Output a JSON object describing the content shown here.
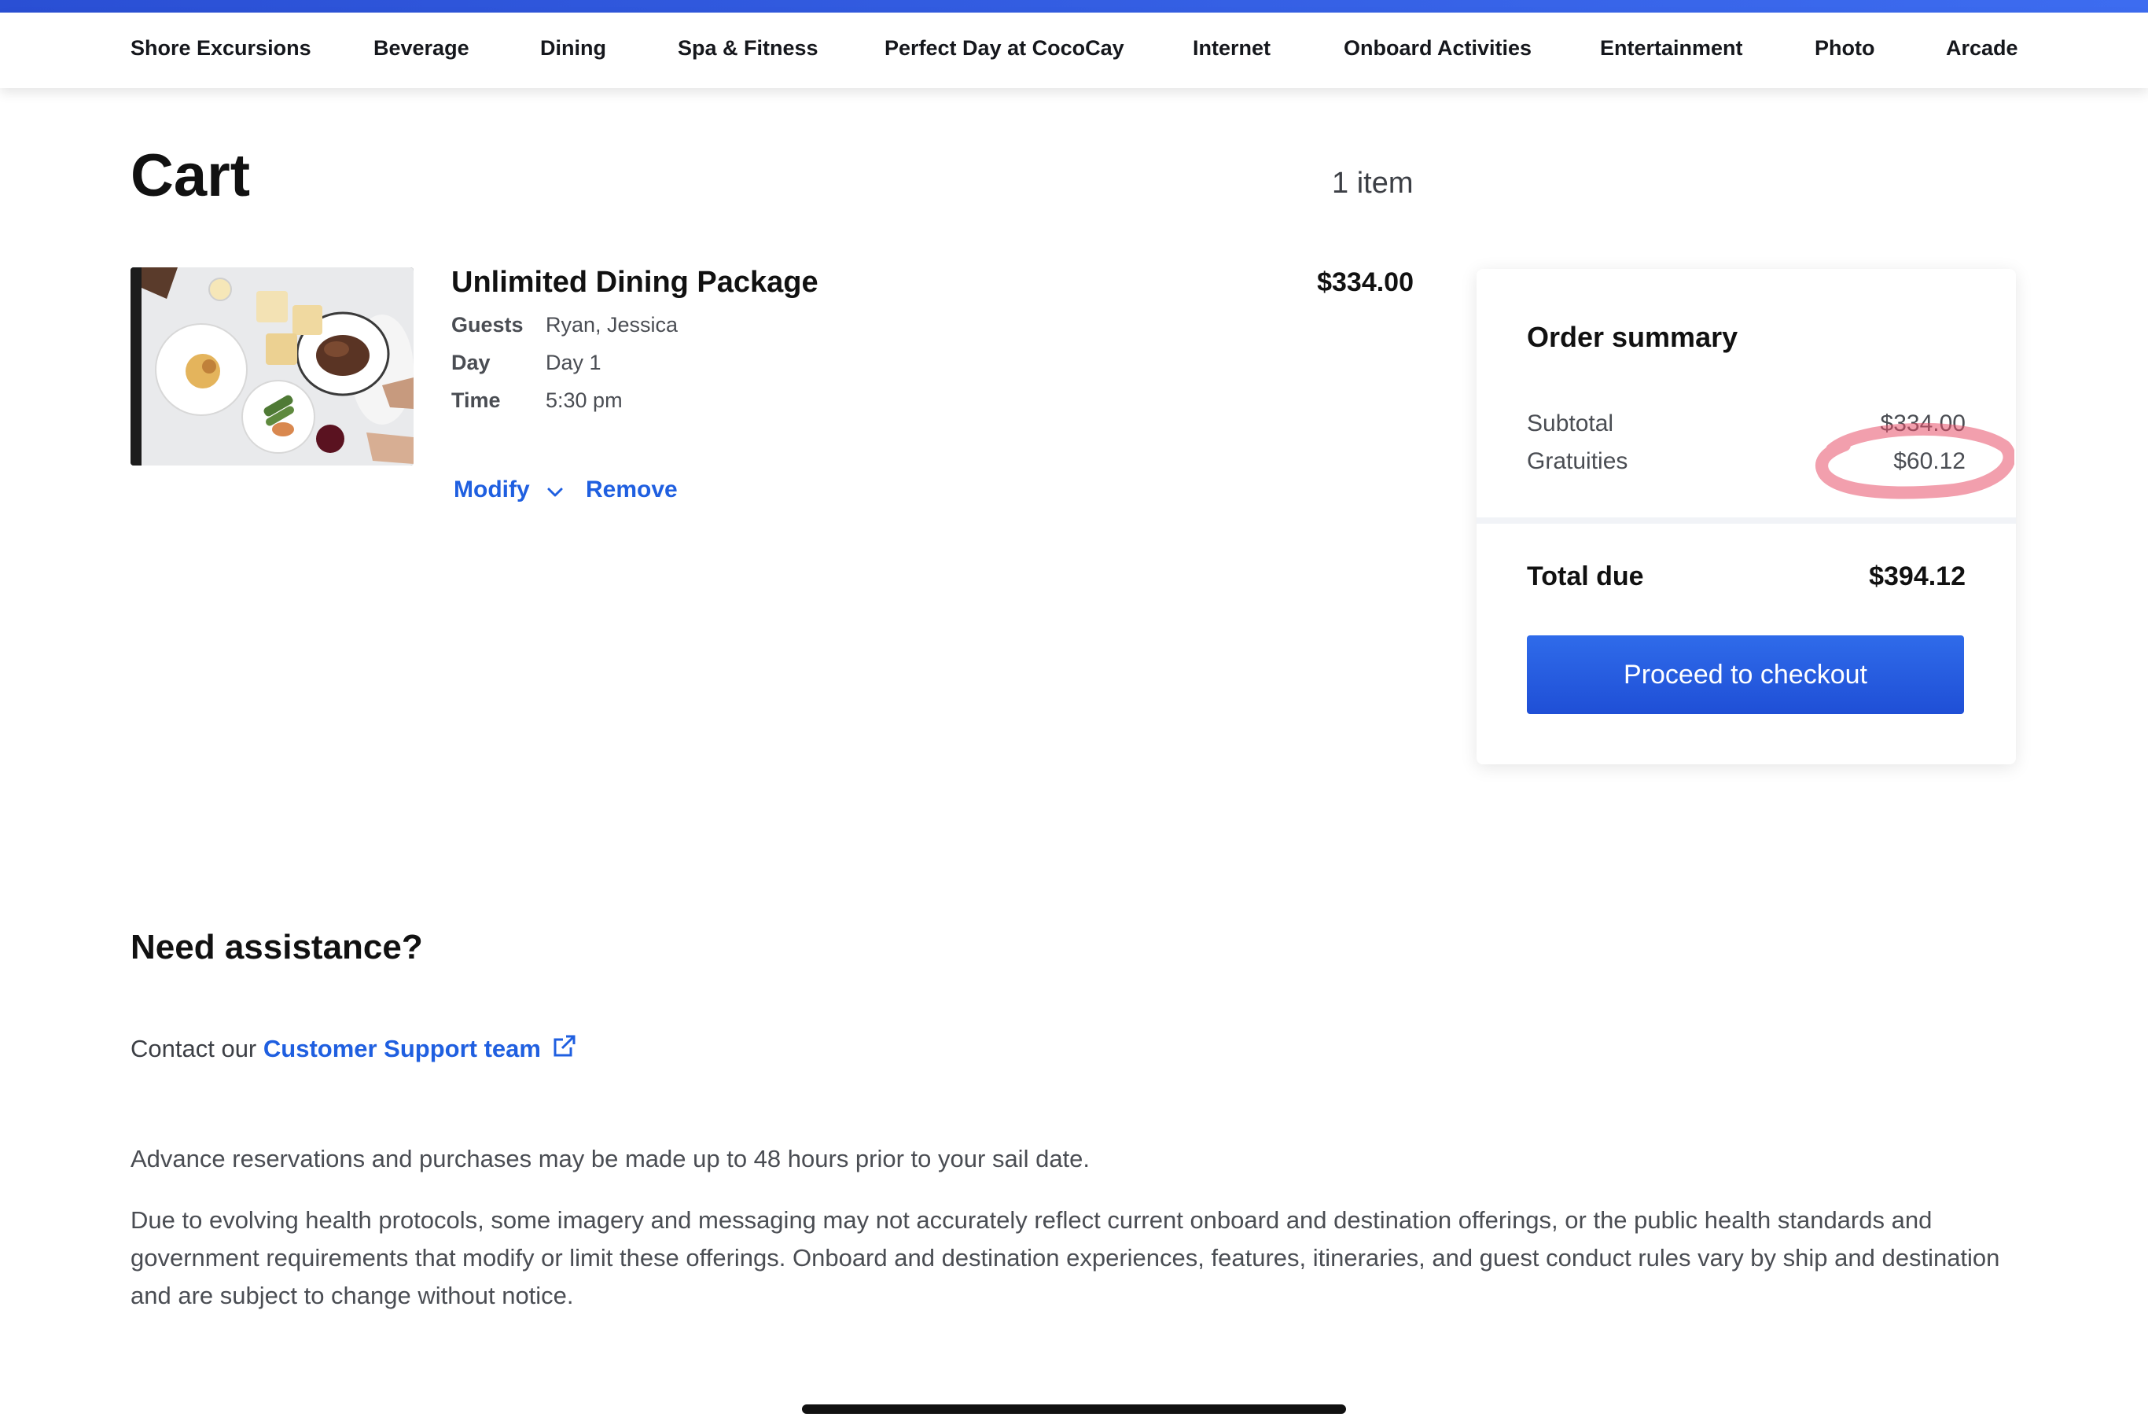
{
  "nav": {
    "items": [
      {
        "label": "Shore Excursions"
      },
      {
        "label": "Beverage"
      },
      {
        "label": "Dining"
      },
      {
        "label": "Spa & Fitness"
      },
      {
        "label": "Perfect Day at CocoCay"
      },
      {
        "label": "Internet"
      },
      {
        "label": "Onboard Activities"
      },
      {
        "label": "Entertainment"
      },
      {
        "label": "Photo"
      },
      {
        "label": "Arcade"
      }
    ]
  },
  "cart": {
    "title": "Cart",
    "item_count": "1 item",
    "item": {
      "name": "Unlimited Dining Package",
      "price": "$334.00",
      "details": [
        {
          "label": "Guests",
          "value": "Ryan, Jessica"
        },
        {
          "label": "Day",
          "value": "Day 1"
        },
        {
          "label": "Time",
          "value": "5:30 pm"
        }
      ],
      "modify_label": "Modify",
      "remove_label": "Remove"
    }
  },
  "summary": {
    "title": "Order summary",
    "subtotal_label": "Subtotal",
    "subtotal_value": "$334.00",
    "gratuities_label": "Gratuities",
    "gratuities_value": "$60.12",
    "total_label": "Total due",
    "total_value": "$394.12",
    "checkout_label": "Proceed to checkout"
  },
  "assistance": {
    "title": "Need assistance?",
    "contact_prefix": "Contact our ",
    "contact_link": "Customer Support team",
    "note_1": "Advance reservations and purchases may be made up to 48 hours prior to your sail date.",
    "note_2": "Due to evolving health protocols, some imagery and messaging may not accurately reflect current onboard and destination offerings, or the public health standards and government requirements that modify or limit these offerings. Onboard and destination experiences, features, itineraries, and guest conduct rules vary by ship and destination and are subject to change without notice."
  },
  "colors": {
    "accent": "#1f5fe0",
    "button": "#2457de",
    "highlight": "#e8506a"
  },
  "icons": {
    "modify_chevron": "chevron-down-icon",
    "external_link": "external-link-icon"
  }
}
